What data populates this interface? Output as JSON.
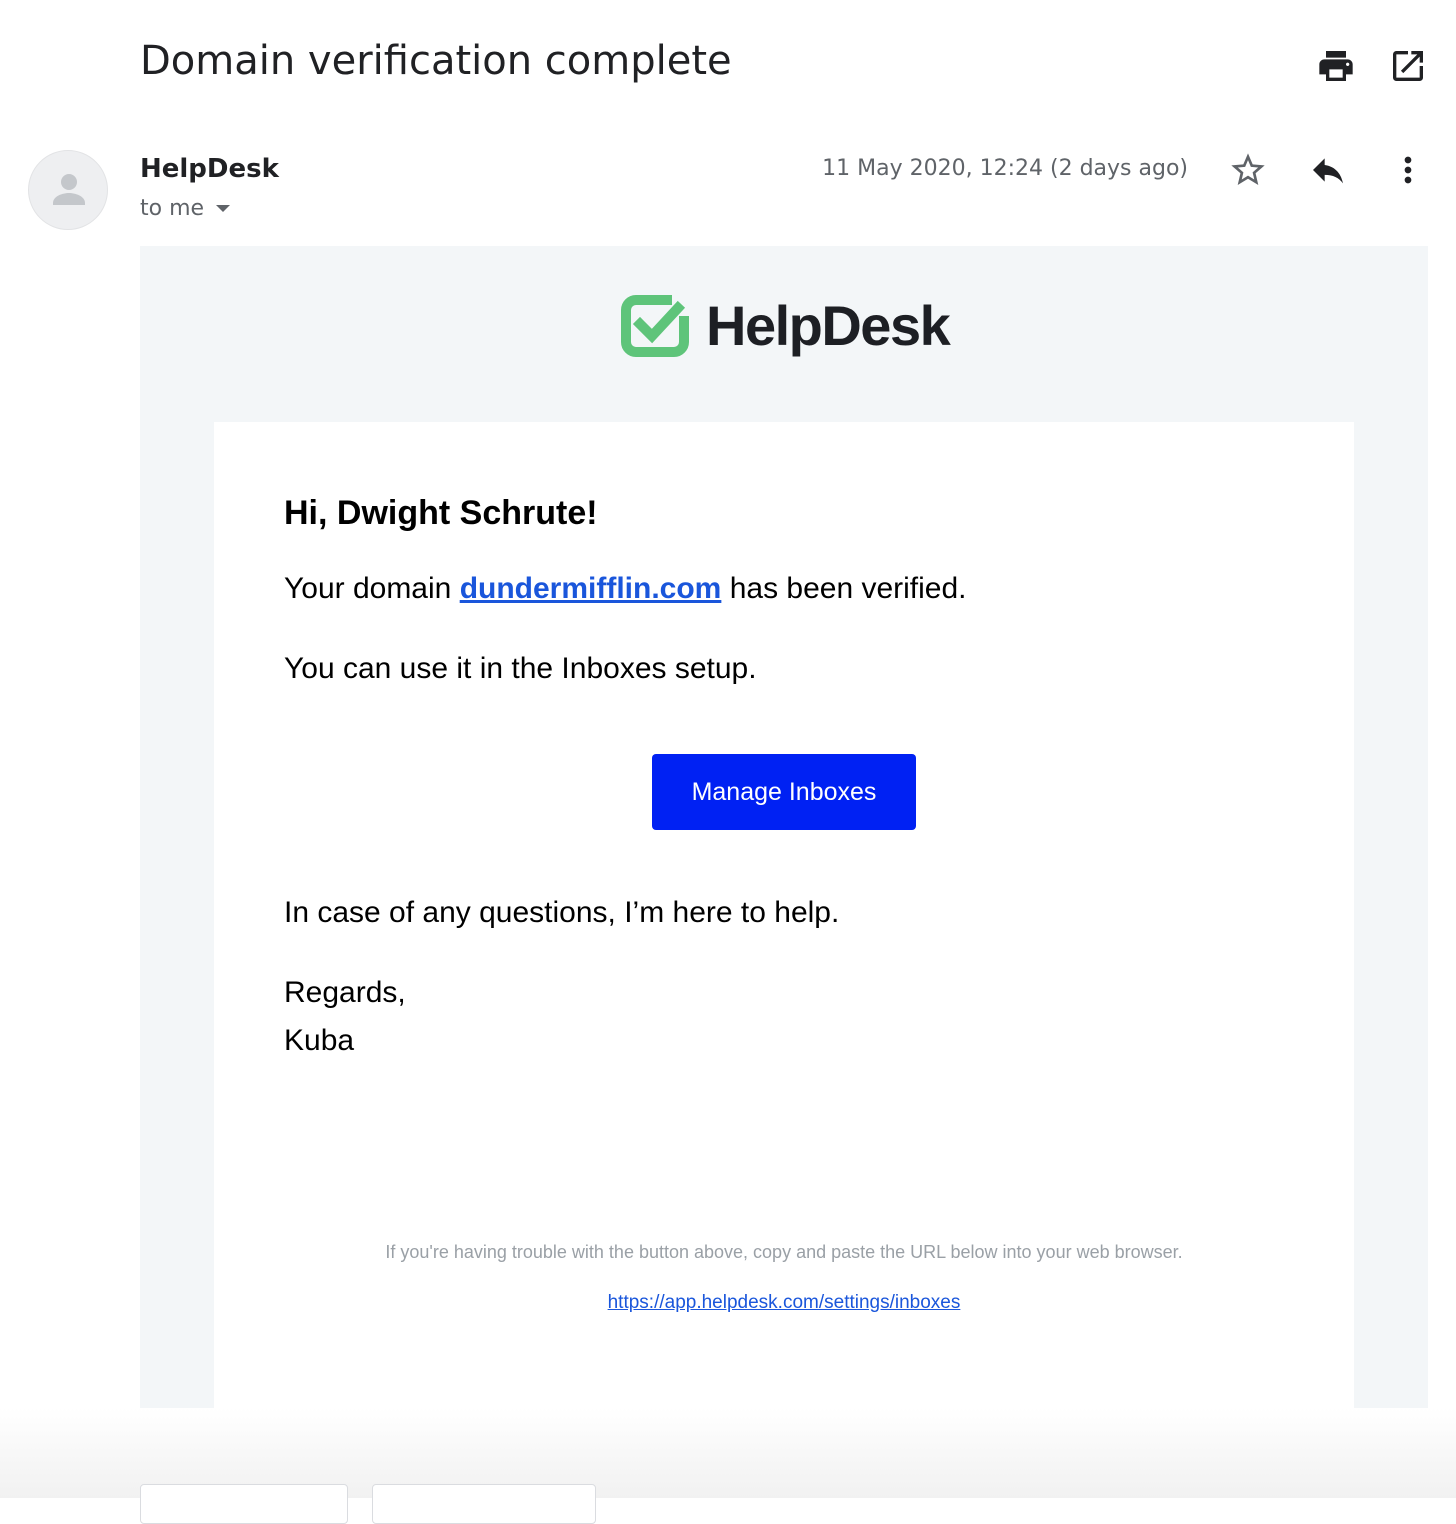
{
  "email": {
    "subject": "Domain verification complete",
    "sender": "HelpDesk",
    "recipients": "to me",
    "date": "11 May 2020, 12:24 (2 days ago)"
  },
  "icons": {
    "print": "print-icon",
    "open_new_window": "open-in-new-window-icon",
    "star": "star-icon",
    "reply": "reply-icon",
    "more": "more-vertical-icon",
    "avatar": "person-icon"
  },
  "body": {
    "logo_text": "HelpDesk",
    "greeting": "Hi, Dwight Schrute!",
    "line1_prefix": "Your domain ",
    "line1_link": "dundermifflin.com",
    "line1_suffix": " has been verified.",
    "line2": "You can use it in the Inboxes setup.",
    "button_label": "Manage Inboxes",
    "help_line": "In case of any questions, I’m here to help.",
    "signoff": "Regards,",
    "signature": "Kuba",
    "fallback_note": "If you're having trouble with the button above, copy and paste the URL below into your web browser.",
    "fallback_url": "https://app.helpdesk.com/settings/inboxes"
  },
  "colors": {
    "brand_green": "#5ec47a",
    "button_blue": "#0021f3",
    "link_blue": "#1a56db",
    "mail_background": "#f3f6f8"
  }
}
